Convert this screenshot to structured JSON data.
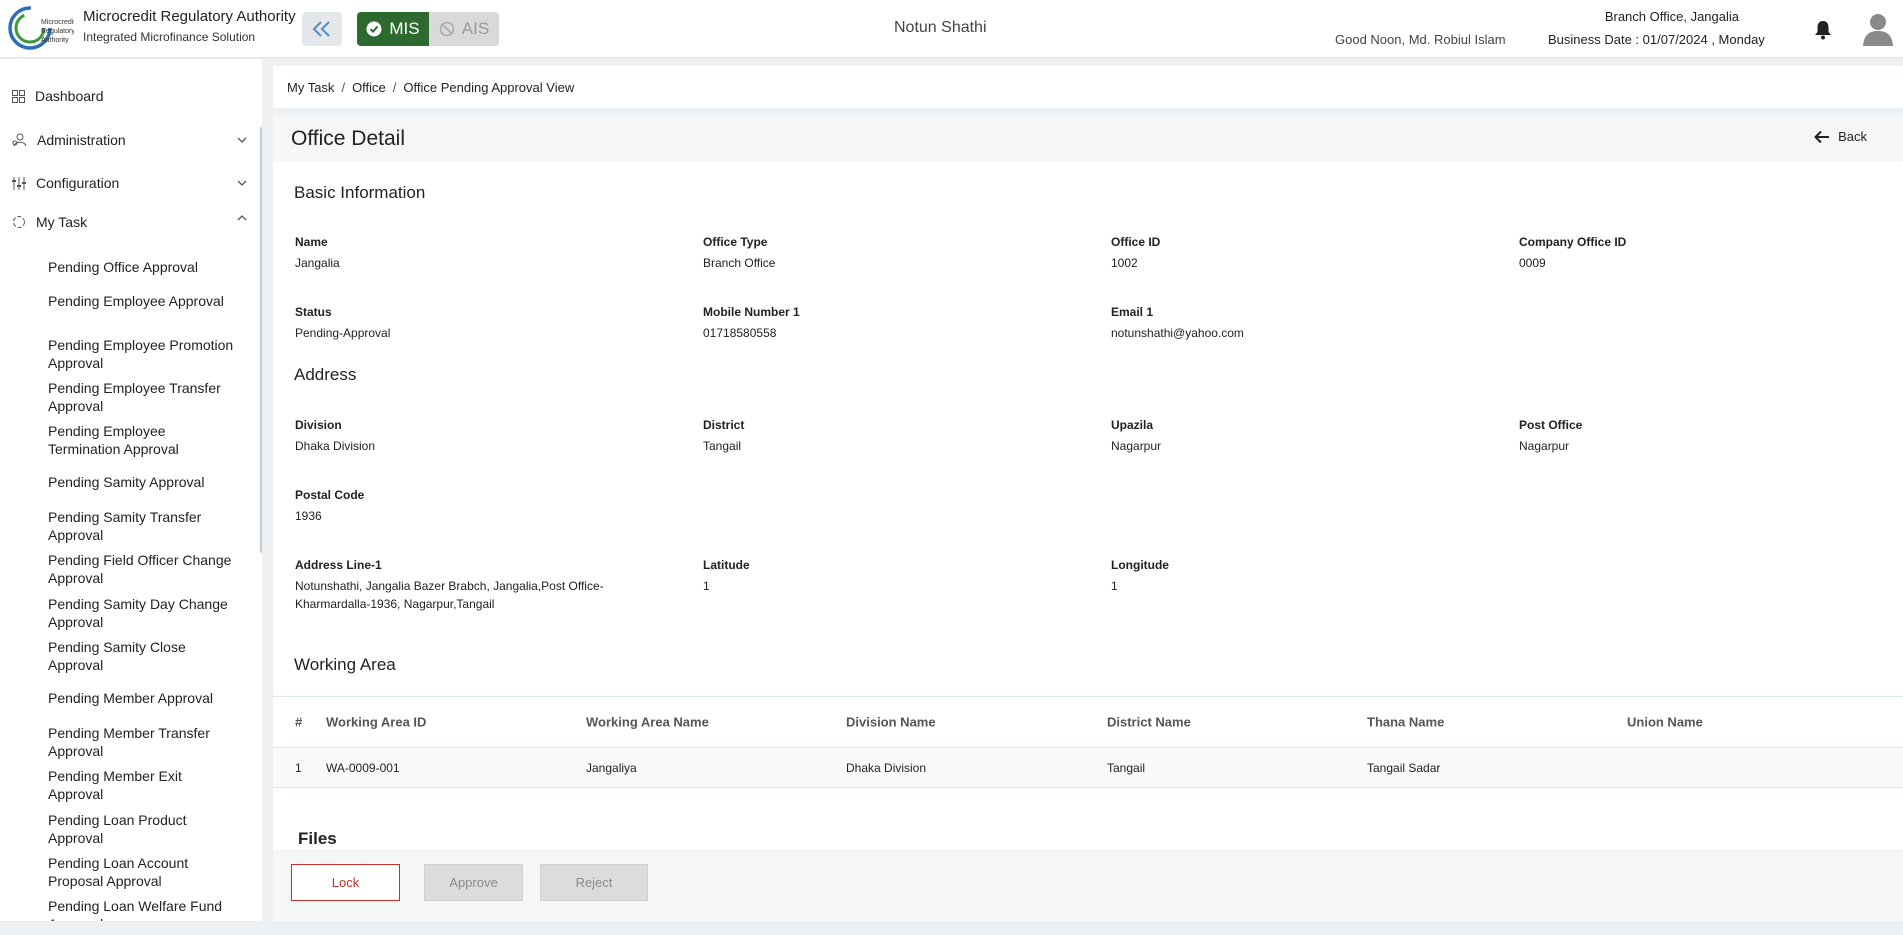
{
  "header": {
    "org_name": "Microcredit Regulatory Authority",
    "org_sub": "Integrated Microfinance Solution",
    "logo_text": "Microcredit Regulatory Authority",
    "mode_mis": "MIS",
    "mode_ais": "AIS",
    "app_title": "Notun Shathi",
    "greeting": "Good Noon, Md. Robiul Islam",
    "branch": "Branch Office, Jangalia",
    "business_date": "Business Date : 01/07/2024 , Monday",
    "brand_color": "#2e6a2f"
  },
  "sidebar": {
    "top_items": [
      {
        "label": "Dashboard",
        "icon": "grid-icon"
      },
      {
        "label": "Administration",
        "icon": "users-icon"
      },
      {
        "label": "Configuration",
        "icon": "sliders-icon"
      },
      {
        "label": "My Task",
        "icon": "refresh-icon"
      }
    ],
    "sub_items": [
      "Pending Office Approval",
      "Pending Employee Approval",
      "Pending Employee Promotion Approval",
      "Pending Employee Transfer Approval",
      "Pending Employee Termination Approval",
      "Pending Samity Approval",
      "Pending Samity Transfer Approval",
      "Pending Field Officer Change Approval",
      "Pending Samity Day Change Approval",
      "Pending Samity Close Approval",
      "Pending Member Approval",
      "Pending Member Transfer Approval",
      "Pending Member Exit Approval",
      "Pending Loan Product Approval",
      "Pending Loan Account Proposal Approval",
      "Pending Loan Welfare Fund Approval"
    ]
  },
  "breadcrumb": [
    "My Task",
    "Office",
    "Office Pending Approval View"
  ],
  "page": {
    "title": "Office Detail",
    "back_label": "Back"
  },
  "basic": {
    "section_title": "Basic Information",
    "fields": [
      {
        "label": "Name",
        "value": "Jangalia"
      },
      {
        "label": "Office Type",
        "value": "Branch Office"
      },
      {
        "label": "Office ID",
        "value": "1002"
      },
      {
        "label": "Company Office ID",
        "value": "0009"
      },
      {
        "label": "Status",
        "value": "Pending-Approval"
      },
      {
        "label": "Mobile Number 1",
        "value": "01718580558"
      },
      {
        "label": "Email 1",
        "value": "notunshathi@yahoo.com"
      }
    ]
  },
  "address": {
    "section_title": "Address",
    "fields": [
      {
        "label": "Division",
        "value": "Dhaka Division"
      },
      {
        "label": "District",
        "value": "Tangail"
      },
      {
        "label": "Upazila",
        "value": "Nagarpur"
      },
      {
        "label": "Post Office",
        "value": "Nagarpur"
      },
      {
        "label": "Postal Code",
        "value": "1936"
      },
      {
        "label": "Address Line-1",
        "value": "Notunshathi, Jangalia Bazer Brabch, Jangalia,Post Office-Kharmardalla-1936, Nagarpur,Tangail"
      },
      {
        "label": "Latitude",
        "value": "1"
      },
      {
        "label": "Longitude",
        "value": "1"
      }
    ]
  },
  "working_area": {
    "section_title": "Working Area",
    "columns": [
      "#",
      "Working Area ID",
      "Working Area Name",
      "Division Name",
      "District Name",
      "Thana Name",
      "Union Name"
    ],
    "rows": [
      [
        "1",
        "WA-0009-001",
        "Jangaliya",
        "Dhaka Division",
        "Tangail",
        "Tangail Sadar",
        ""
      ]
    ]
  },
  "files": {
    "section_title": "Files",
    "lock_label": "Lock",
    "approve_label": "Approve",
    "reject_label": "Reject"
  }
}
